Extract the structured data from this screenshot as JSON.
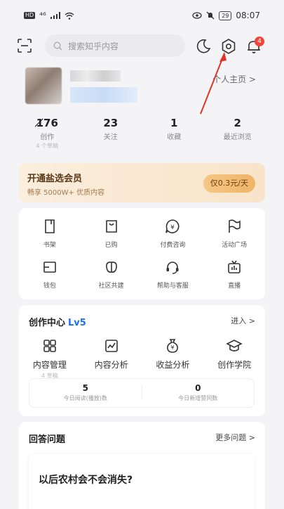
{
  "status": {
    "time": "08:07",
    "network": "⁴⁶",
    "battery": "29"
  },
  "top": {
    "search_placeholder": "搜索知乎内容",
    "notif_count": "4"
  },
  "profile": {
    "homepage_label": "个人主页 >"
  },
  "stats": [
    {
      "num": "1̸76",
      "label": "创作",
      "sub": "4 个草稿"
    },
    {
      "num": "23",
      "label": "关注",
      "sub": ""
    },
    {
      "num": "1",
      "label": "收藏",
      "sub": ""
    },
    {
      "num": "2",
      "label": "最近浏览",
      "sub": ""
    }
  ],
  "vip": {
    "title": "开通盐选会员",
    "subtitle": "畅享 5000W+ 优质内容",
    "price": "仅0.3元/天"
  },
  "services": [
    {
      "label": "书架",
      "icon": "bookshelf-icon"
    },
    {
      "label": "已购",
      "icon": "purchased-icon"
    },
    {
      "label": "付费咨询",
      "icon": "paid-consult-icon"
    },
    {
      "label": "活动广场",
      "icon": "flag-icon"
    },
    {
      "label": "钱包",
      "icon": "wallet-icon"
    },
    {
      "label": "社区共建",
      "icon": "community-icon"
    },
    {
      "label": "帮助与客服",
      "icon": "headset-icon"
    },
    {
      "label": "直播",
      "icon": "live-icon"
    }
  ],
  "creation": {
    "title": "创作中心",
    "level": "Lv5",
    "enter": "进入 >",
    "tools": [
      {
        "label": "内容管理",
        "sub": "4 草稿"
      },
      {
        "label": "内容分析",
        "sub": ""
      },
      {
        "label": "收益分析",
        "sub": ""
      },
      {
        "label": "创作学院",
        "sub": ""
      }
    ],
    "today_reads": "5",
    "today_reads_label": "今日阅读(播放)数",
    "today_likes": "0",
    "today_likes_label": "今日新增赞同数"
  },
  "answer": {
    "title": "回答问题",
    "more": "更多问题 >",
    "question": "以后农村会不会消失?"
  }
}
